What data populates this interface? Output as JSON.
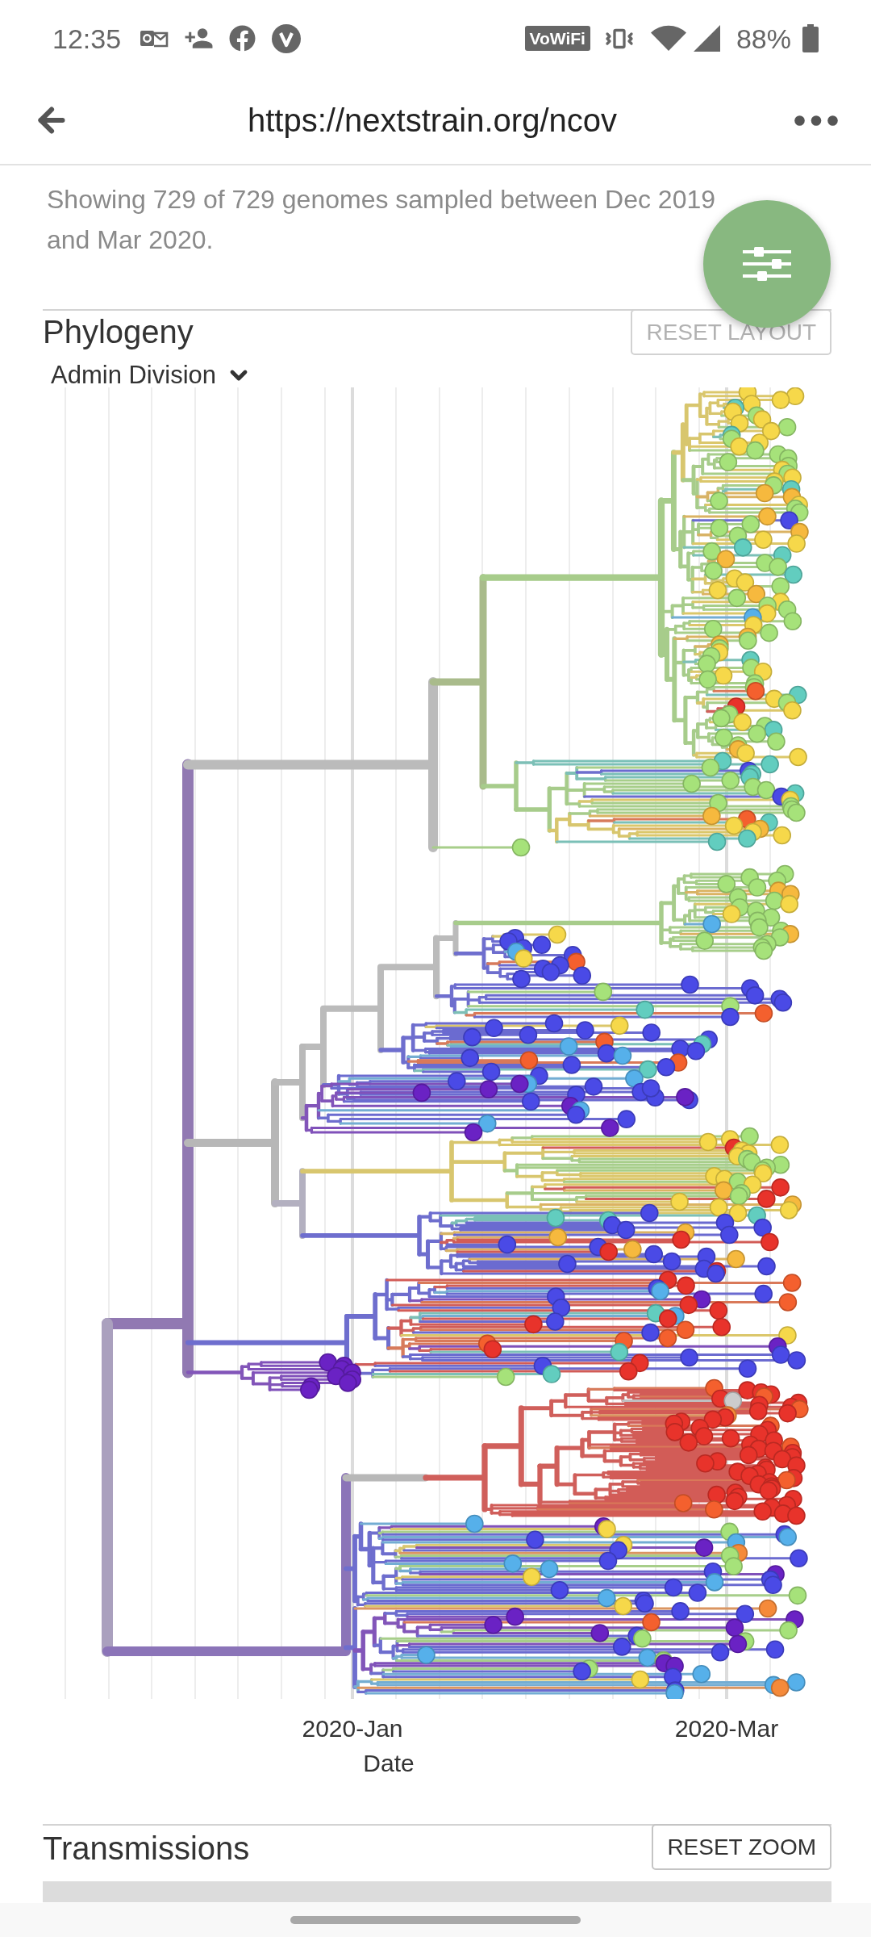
{
  "status_bar": {
    "time": "12:35",
    "calling_badge": "VoWiFi",
    "battery": "88%"
  },
  "browser": {
    "url": "https://nextstrain.org/ncov"
  },
  "summary": "Showing 729 of 729 genomes sampled between Dec 2019 and Mar 2020.",
  "phylogeny": {
    "title": "Phylogeny",
    "reset_button": {
      "label": "RESET LAYOUT",
      "disabled": true
    },
    "color_by": "Admin Division",
    "x_ticks": [
      "2020-Jan",
      "2020-Mar"
    ],
    "x_label": "Date"
  },
  "transmissions": {
    "title": "Transmissions",
    "reset_button": {
      "label": "RESET ZOOM",
      "disabled": false
    }
  }
}
